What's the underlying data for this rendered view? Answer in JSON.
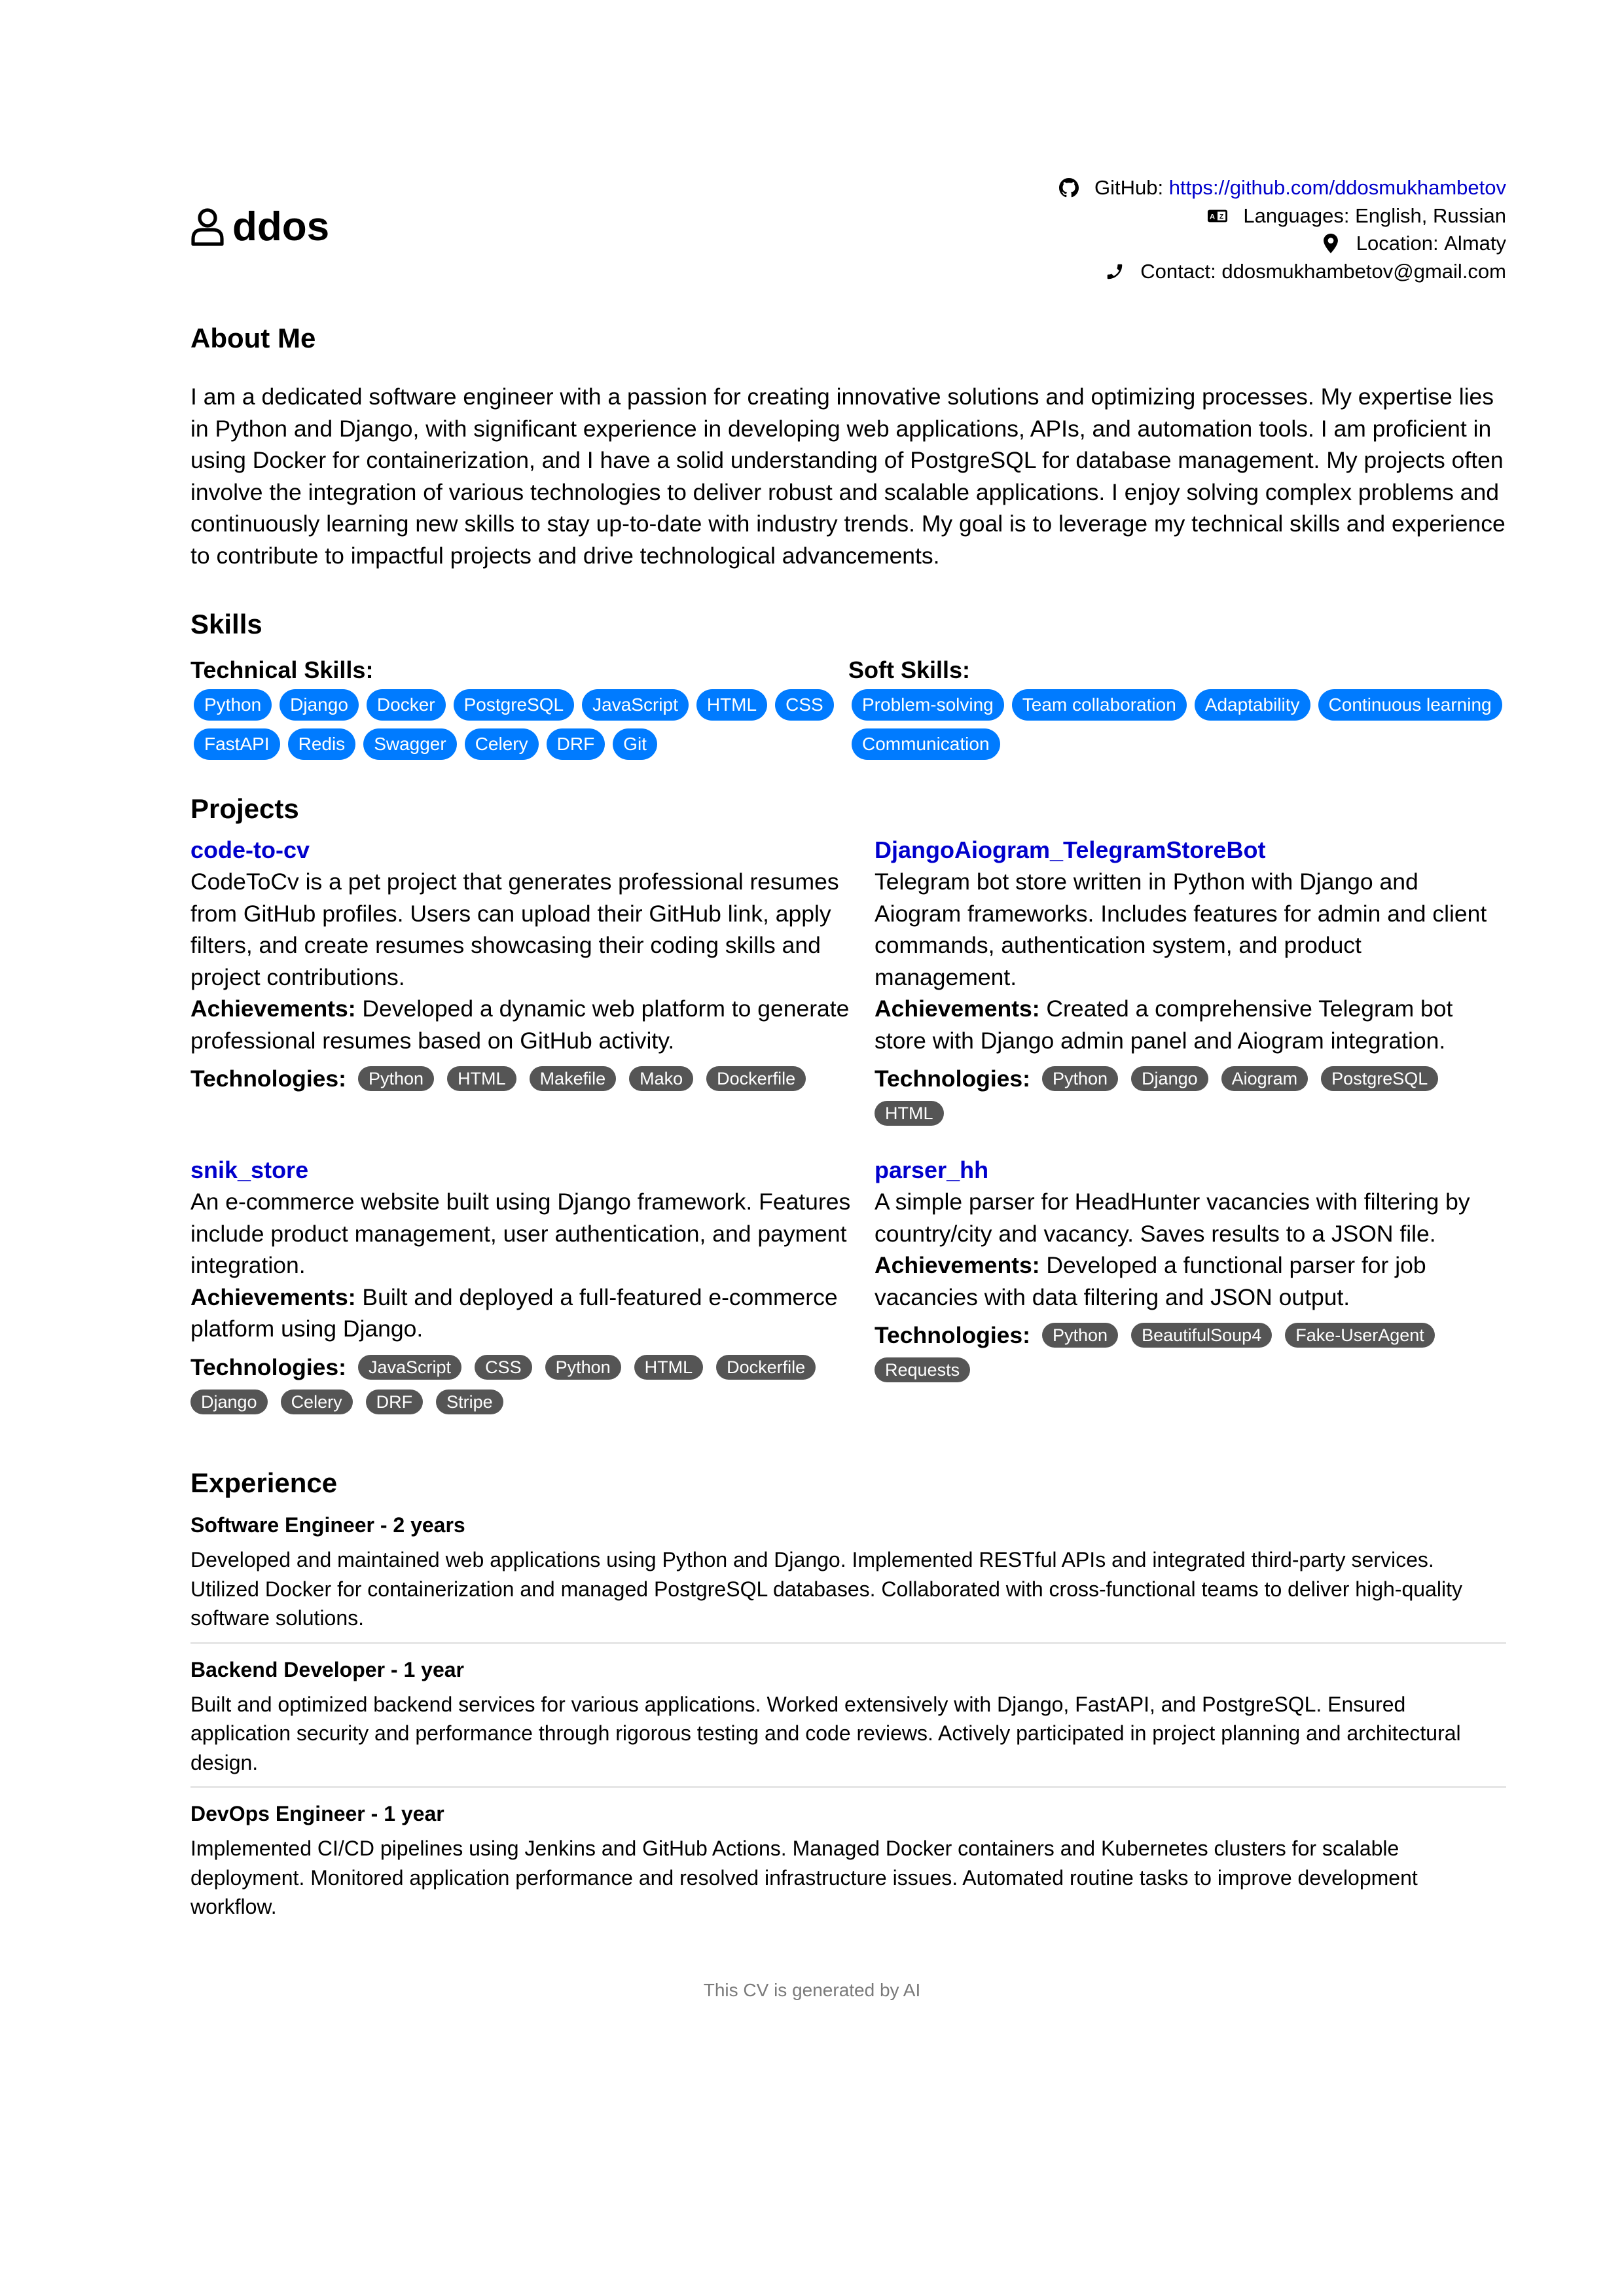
{
  "header": {
    "name": "ddos",
    "user_icon": "user-icon",
    "contacts": [
      {
        "icon": "github-icon",
        "label": "GitHub: ",
        "value": "https://github.com/ddosmukhambetov",
        "is_link": true
      },
      {
        "icon": "language-icon",
        "label": "Languages: ",
        "value": "English, Russian",
        "is_link": false
      },
      {
        "icon": "location-pin-icon",
        "label": "Location: ",
        "value": "Almaty",
        "is_link": false
      },
      {
        "icon": "phone-icon",
        "label": "Contact: ",
        "value": "ddosmukhambetov@gmail.com",
        "is_link": false
      }
    ]
  },
  "about": {
    "heading": "About Me",
    "text": "I am a dedicated software engineer with a passion for creating innovative solutions and optimizing processes. My expertise lies in Python and Django, with significant experience in developing web applications, APIs, and automation tools. I am proficient in using Docker for containerization, and I have a solid understanding of PostgreSQL for database management. My projects often involve the integration of various technologies to deliver robust and scalable applications. I enjoy solving complex problems and continuously learning new skills to stay up-to-date with industry trends. My goal is to leverage my technical skills and experience to contribute to impactful projects and drive technological advancements."
  },
  "skills": {
    "heading": "Skills",
    "technical": {
      "label": "Technical Skills:",
      "items": [
        "Python",
        "Django",
        "Docker",
        "PostgreSQL",
        "JavaScript",
        "HTML",
        "CSS",
        "FastAPI",
        "Redis",
        "Swagger",
        "Celery",
        "DRF",
        "Git"
      ]
    },
    "soft": {
      "label": "Soft Skills:",
      "items": [
        "Problem-solving",
        "Team collaboration",
        "Adaptability",
        "Continuous learning",
        "Communication"
      ]
    }
  },
  "projects": {
    "heading": "Projects",
    "achievements_label": "Achievements:",
    "technologies_label": "Technologies:",
    "items": [
      {
        "title": "code-to-cv",
        "description": "CodeToCv is a pet project that generates professional resumes from GitHub profiles. Users can upload their GitHub link, apply filters, and create resumes showcasing their coding skills and project contributions.",
        "achievements": "Developed a dynamic web platform to generate professional resumes based on GitHub activity.",
        "technologies": [
          "Python",
          "HTML",
          "Makefile",
          "Mako",
          "Dockerfile"
        ]
      },
      {
        "title": "DjangoAiogram_TelegramStoreBot",
        "description": "Telegram bot store written in Python with Django and Aiogram frameworks. Includes features for admin and client commands, authentication system, and product management.",
        "achievements": "Created a comprehensive Telegram bot store with Django admin panel and Aiogram integration.",
        "technologies": [
          "Python",
          "Django",
          "Aiogram",
          "PostgreSQL",
          "HTML"
        ]
      },
      {
        "title": "snik_store",
        "description": "An e-commerce website built using Django framework. Features include product management, user authentication, and payment integration.",
        "achievements": "Built and deployed a full-featured e-commerce platform using Django.",
        "technologies": [
          "JavaScript",
          "CSS",
          "Python",
          "HTML",
          "Dockerfile",
          "Django",
          "Celery",
          "DRF",
          "Stripe"
        ]
      },
      {
        "title": "parser_hh",
        "description": "A simple parser for HeadHunter vacancies with filtering by country/city and vacancy. Saves results to a JSON file.",
        "achievements": "Developed a functional parser for job vacancies with data filtering and JSON output.",
        "technologies": [
          "Python",
          "BeautifulSoup4",
          "Fake-UserAgent",
          "Requests"
        ]
      }
    ]
  },
  "experience": {
    "heading": "Experience",
    "items": [
      {
        "title": "Software Engineer - 2 years",
        "description": "Developed and maintained web applications using Python and Django. Implemented RESTful APIs and integrated third-party services. Utilized Docker for containerization and managed PostgreSQL databases. Collaborated with cross-functional teams to deliver high-quality software solutions."
      },
      {
        "title": "Backend Developer - 1 year",
        "description": "Built and optimized backend services for various applications. Worked extensively with Django, FastAPI, and PostgreSQL. Ensured application security and performance through rigorous testing and code reviews. Actively participated in project planning and architectural design."
      },
      {
        "title": "DevOps Engineer - 1 year",
        "description": "Implemented CI/CD pipelines using Jenkins and GitHub Actions. Managed Docker containers and Kubernetes clusters for scalable deployment. Monitored application performance and resolved infrastructure issues. Automated routine tasks to improve development workflow."
      }
    ]
  },
  "footer": {
    "text": "This CV is generated by AI"
  },
  "colors": {
    "link": "#0000cc",
    "skill_badge": "#007bff",
    "tech_badge": "#555555",
    "footer_text": "#7a7a7a"
  }
}
